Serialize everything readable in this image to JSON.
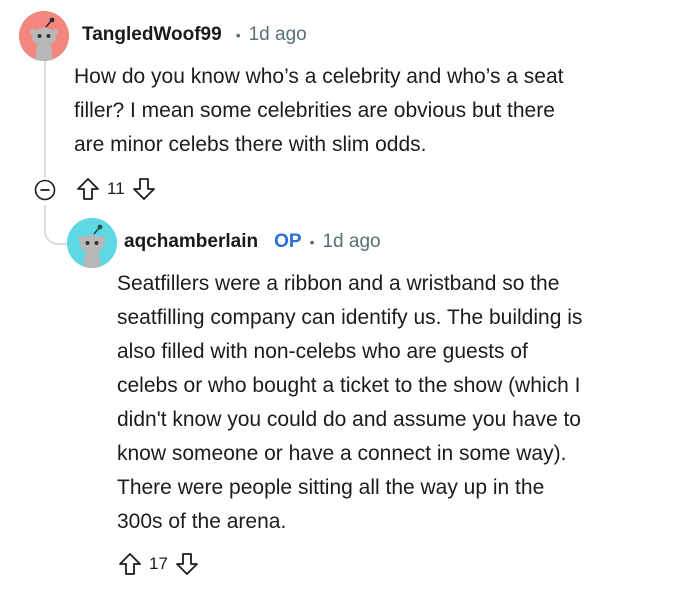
{
  "comment": {
    "author": "TangledWoof99",
    "separator": "•",
    "time": "1d ago",
    "lines": [
      "How do you know who’s a celebrity and who’s a seat",
      "filler? I mean some celebrities are obvious but there",
      "are minor celebs there with slim odds."
    ],
    "votes": "11",
    "avatar_color": "#f3877f"
  },
  "reply": {
    "author": "aqchamberlain",
    "op_badge": "OP",
    "separator": "•",
    "time": "1d ago",
    "lines": [
      "Seatfillers were a ribbon and a wristband so the",
      "seatfilling company can identify us. The building is",
      "also filled with non-celebs who are guests of",
      "celebs or who bought a ticket to the show (which I",
      "didn't know you could do and assume you have to",
      "know someone or have a connect in some way).",
      "There were people sitting all the way up in the",
      "300s of the arena."
    ],
    "votes": "17",
    "avatar_color": "#5fd8e6"
  },
  "icons": {
    "collapse": "collapse-minus-icon",
    "upvote": "upvote-arrow-icon",
    "downvote": "downvote-arrow-icon"
  }
}
